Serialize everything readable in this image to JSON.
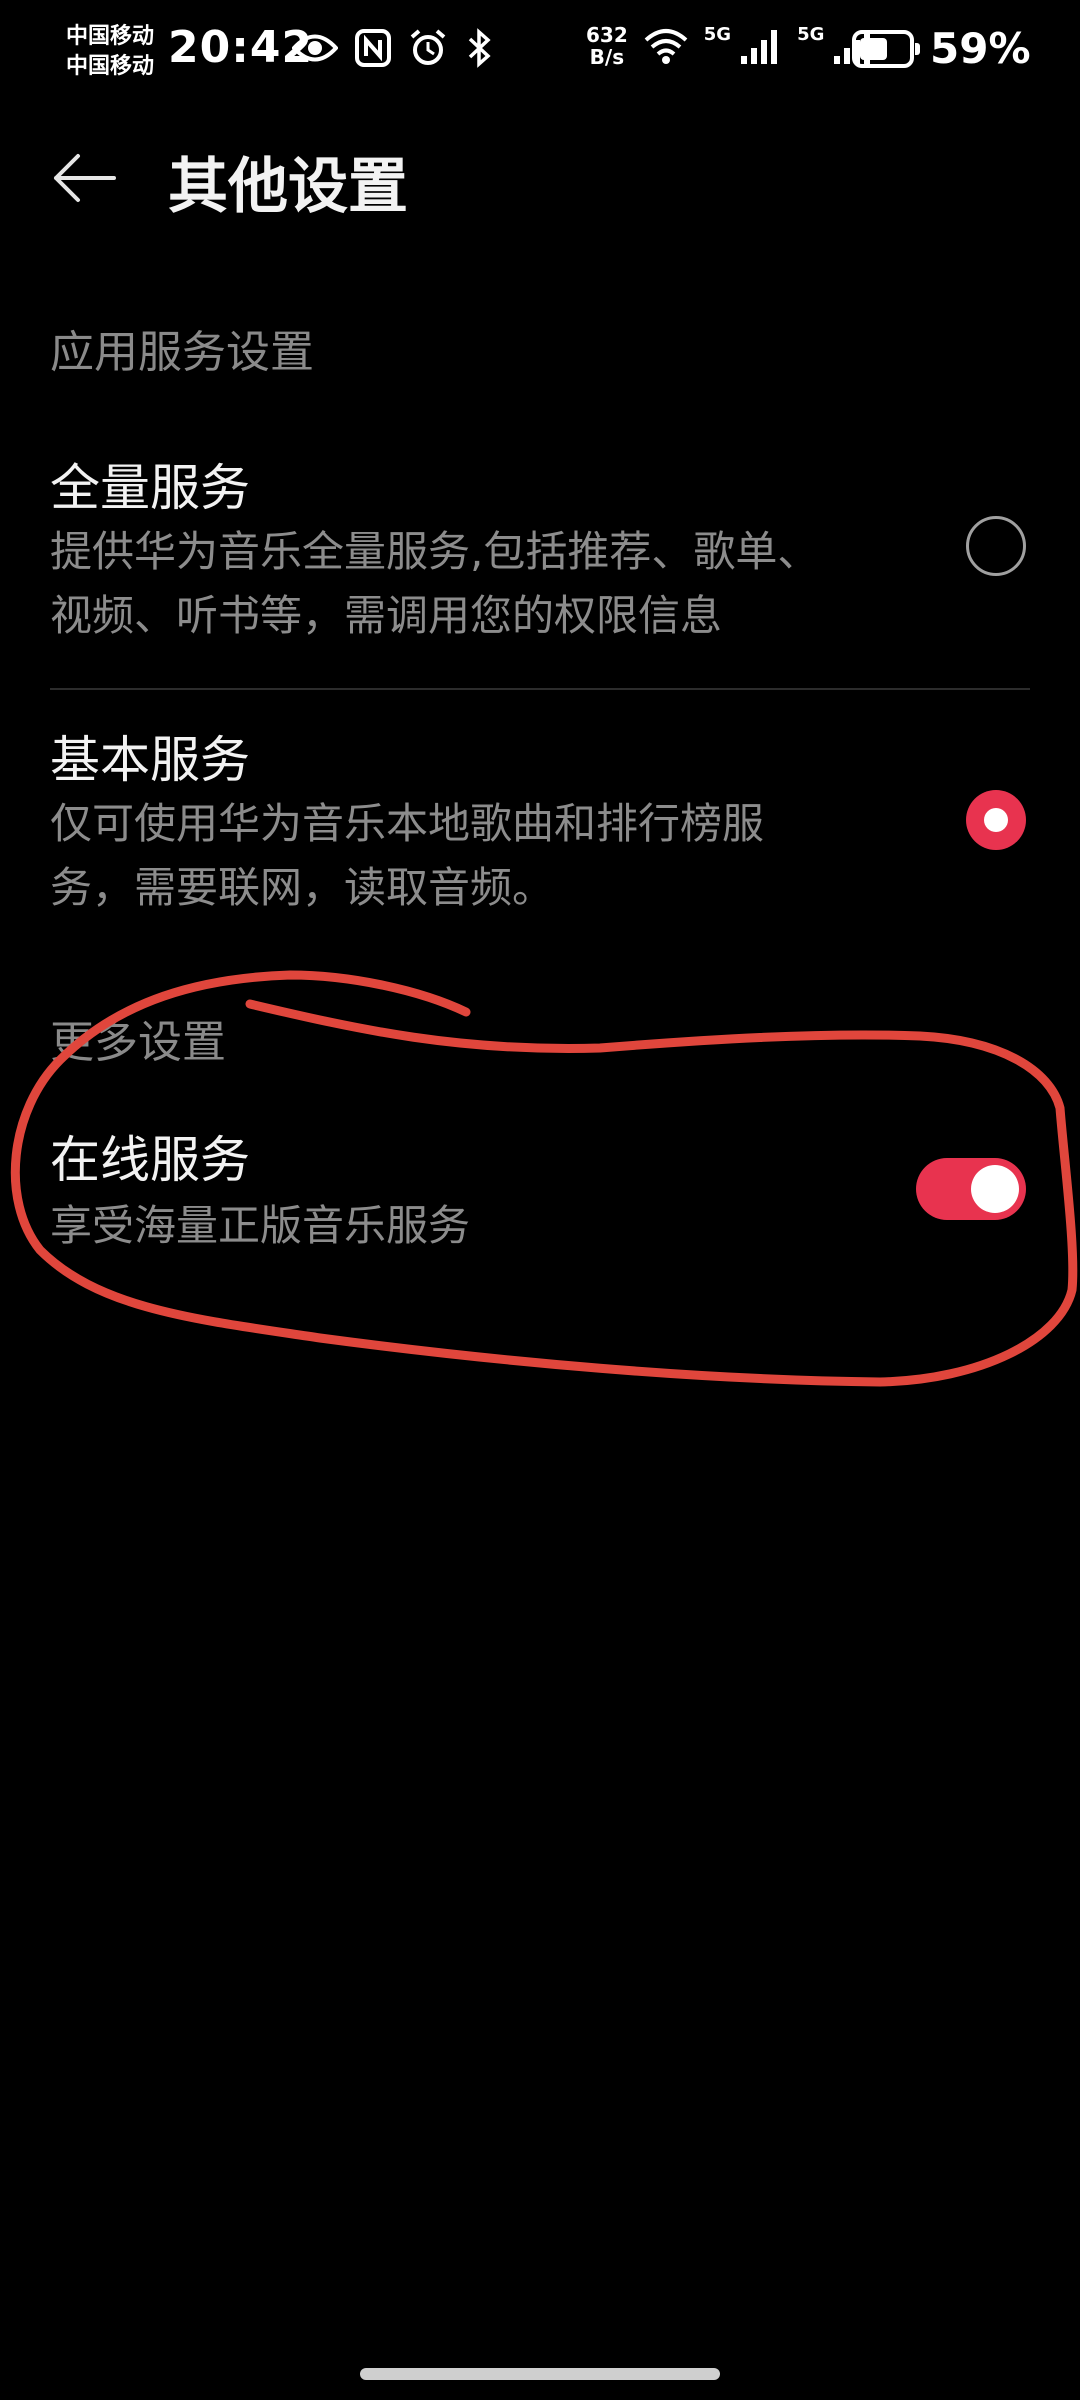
{
  "status_bar": {
    "carrier_1": "中国移动",
    "carrier_2": "中国移动",
    "time": "20:42",
    "net_speed_value": "632",
    "net_speed_unit": "B/s",
    "sim1_network": "5G",
    "sim2_network": "5G",
    "battery_percent": "59%",
    "battery_level": 0.59,
    "icons": [
      "eye-icon",
      "nfc-icon",
      "alarm-icon",
      "bluetooth-icon",
      "wifi-icon",
      "signal-icon",
      "signal-icon",
      "battery-icon"
    ]
  },
  "header": {
    "title": "其他设置",
    "back_icon": "arrow-left-icon"
  },
  "sections": {
    "app_service": "应用服务设置",
    "more": "更多设置"
  },
  "items": {
    "full_service": {
      "title": "全量服务",
      "desc_line1": "提供华为音乐全量服务,包括推荐、歌单、",
      "desc_line2": "视频、听书等，需调用您的权限信息",
      "selected": false
    },
    "basic_service": {
      "title": "基本服务",
      "desc_line1": "仅可使用华为音乐本地歌曲和排行榜服",
      "desc_line2": "务，需要联网，读取音频。",
      "selected": true
    },
    "online_service": {
      "title": "在线服务",
      "desc": "享受海量正版音乐服务",
      "enabled": true
    }
  },
  "colors": {
    "accent": "#e8334f",
    "annotation": "#e0463c",
    "background": "#000000"
  }
}
